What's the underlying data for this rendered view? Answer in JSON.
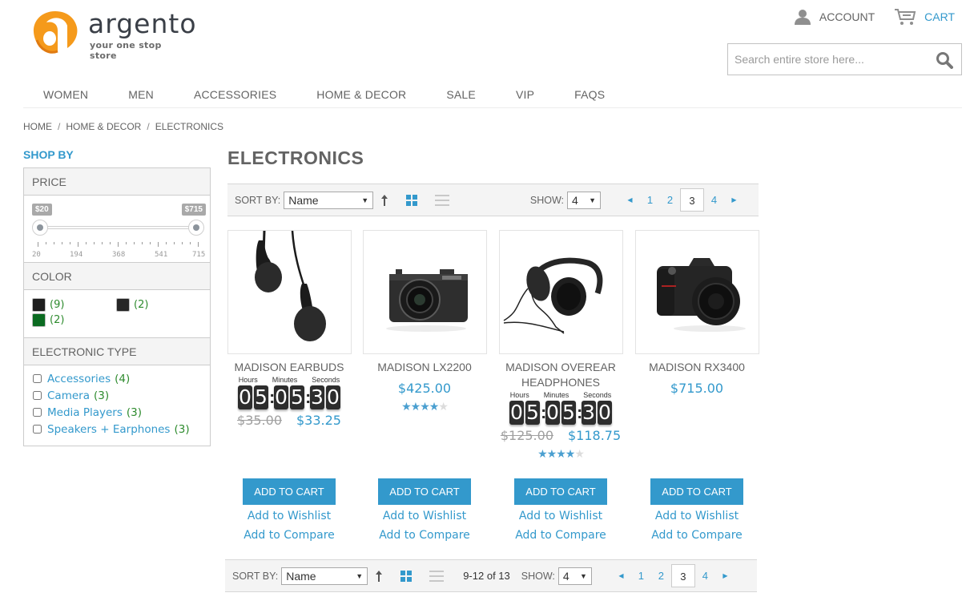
{
  "brand": {
    "name": "argento",
    "tagline": "your one stop store",
    "accent": "#3399cc",
    "logo_orange": "#f59a1b"
  },
  "header": {
    "account_label": "ACCOUNT",
    "cart_label": "CART",
    "search_placeholder": "Search entire store here..."
  },
  "nav": [
    "WOMEN",
    "MEN",
    "ACCESSORIES",
    "HOME & DECOR",
    "SALE",
    "VIP",
    "FAQS"
  ],
  "breadcrumb": [
    "HOME",
    "HOME & DECOR",
    "ELECTRONICS"
  ],
  "breadcrumb_sep": "/",
  "sidebar": {
    "title": "SHOP BY",
    "price": {
      "title": "PRICE",
      "min_label": "$20",
      "max_label": "$715",
      "range_min": 20,
      "range_max": 715,
      "selected_min": 20,
      "selected_max": 715,
      "ticks": [
        "20",
        "194",
        "368",
        "541",
        "715"
      ]
    },
    "color": {
      "title": "COLOR",
      "swatches": [
        {
          "color": "#1e1e1e",
          "count": "(9)"
        },
        {
          "color": "#262626",
          "count": "(2)"
        },
        {
          "color": "#0b6b21",
          "count": "(2)"
        }
      ]
    },
    "electronic_type": {
      "title": "ELECTRONIC TYPE",
      "items": [
        {
          "label": "Accessories",
          "count": "(4)"
        },
        {
          "label": "Camera",
          "count": "(3)"
        },
        {
          "label": "Media Players",
          "count": "(3)"
        },
        {
          "label": "Speakers + Earphones",
          "count": "(3)"
        }
      ]
    }
  },
  "main": {
    "title": "ELECTRONICS",
    "toolbar": {
      "sort_label": "SORT BY:",
      "sort_value": "Name",
      "show_label": "SHOW:",
      "show_value": "4",
      "amount": "9-12 of 13",
      "pages": [
        "1",
        "2",
        "3",
        "4"
      ],
      "current_page": "3"
    },
    "countdown_labels": {
      "hours": "Hours",
      "minutes": "Minutes",
      "seconds": "Seconds"
    },
    "products": [
      {
        "name": "MADISON EARBUDS",
        "image": "earbuds",
        "countdown": [
          "0",
          "5",
          "0",
          "5",
          "3",
          "0"
        ],
        "old_price": "$35.00",
        "price": "$33.25",
        "rating": null
      },
      {
        "name": "MADISON LX2200",
        "image": "compact-camera",
        "countdown": null,
        "old_price": null,
        "price": "$425.00",
        "rating": 4
      },
      {
        "name": "MADISON OVEREAR HEADPHONES",
        "image": "headphones",
        "countdown": [
          "0",
          "5",
          "0",
          "5",
          "3",
          "0"
        ],
        "old_price": "$125.00",
        "price": "$118.75",
        "rating": 4
      },
      {
        "name": "MADISON RX3400",
        "image": "dslr-camera",
        "countdown": null,
        "old_price": null,
        "price": "$715.00",
        "rating": null
      }
    ],
    "actions": {
      "add_to_cart": "ADD TO CART",
      "add_to_wishlist": "Add to Wishlist",
      "add_to_compare": "Add to Compare"
    }
  }
}
